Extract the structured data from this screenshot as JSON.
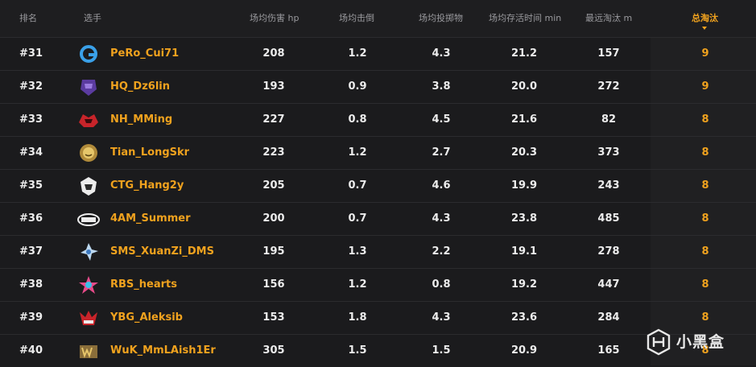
{
  "header": {
    "rank": "排名",
    "player": "选手",
    "avg_damage": "场均伤害 hp",
    "avg_kills": "场均击倒",
    "avg_throws": "场均投掷物",
    "avg_survival": "场均存活时间 min",
    "longest_kill": "最远淘汰 m",
    "total_kills": "总淘汰"
  },
  "rows": [
    {
      "rank": "#31",
      "name": "PeRo_Cui71",
      "damage": "208",
      "kills": "1.2",
      "throws": "4.3",
      "survival": "21.2",
      "far": "157",
      "total": "9",
      "logo": "pero-team-logo"
    },
    {
      "rank": "#32",
      "name": "HQ_Dz6lin",
      "damage": "193",
      "kills": "0.9",
      "throws": "3.8",
      "survival": "20.0",
      "far": "272",
      "total": "9",
      "logo": "hq-team-logo"
    },
    {
      "rank": "#33",
      "name": "NH_MMing",
      "damage": "227",
      "kills": "0.8",
      "throws": "4.5",
      "survival": "21.6",
      "far": "82",
      "total": "8",
      "logo": "nh-team-logo"
    },
    {
      "rank": "#34",
      "name": "Tian_LongSkr",
      "damage": "223",
      "kills": "1.2",
      "throws": "2.7",
      "survival": "20.3",
      "far": "373",
      "total": "8",
      "logo": "tian-team-logo"
    },
    {
      "rank": "#35",
      "name": "CTG_Hang2y",
      "damage": "205",
      "kills": "0.7",
      "throws": "4.6",
      "survival": "19.9",
      "far": "243",
      "total": "8",
      "logo": "ctg-team-logo"
    },
    {
      "rank": "#36",
      "name": "4AM_Summer",
      "damage": "200",
      "kills": "0.7",
      "throws": "4.3",
      "survival": "23.8",
      "far": "485",
      "total": "8",
      "logo": "4am-team-logo"
    },
    {
      "rank": "#37",
      "name": "SMS_XuanZi_DMS",
      "damage": "195",
      "kills": "1.3",
      "throws": "2.2",
      "survival": "19.1",
      "far": "278",
      "total": "8",
      "logo": "sms-team-logo"
    },
    {
      "rank": "#38",
      "name": "RBS_hearts",
      "damage": "156",
      "kills": "1.2",
      "throws": "0.8",
      "survival": "19.2",
      "far": "447",
      "total": "8",
      "logo": "rbs-team-logo"
    },
    {
      "rank": "#39",
      "name": "YBG_Aleksib",
      "damage": "153",
      "kills": "1.8",
      "throws": "4.3",
      "survival": "23.6",
      "far": "284",
      "total": "8",
      "logo": "ybg-team-logo"
    },
    {
      "rank": "#40",
      "name": "WuK_MmLAish1Er",
      "damage": "305",
      "kills": "1.5",
      "throws": "1.5",
      "survival": "20.9",
      "far": "165",
      "total": "8",
      "logo": "wuk-team-logo"
    }
  ],
  "watermark": {
    "text": "小黑盒",
    "icon": "xiaoheihe-logo-icon"
  },
  "colors": {
    "accent": "#f0a21e",
    "background": "#1b1b1d",
    "text": "#ececec",
    "muted": "#9a9a9e"
  }
}
